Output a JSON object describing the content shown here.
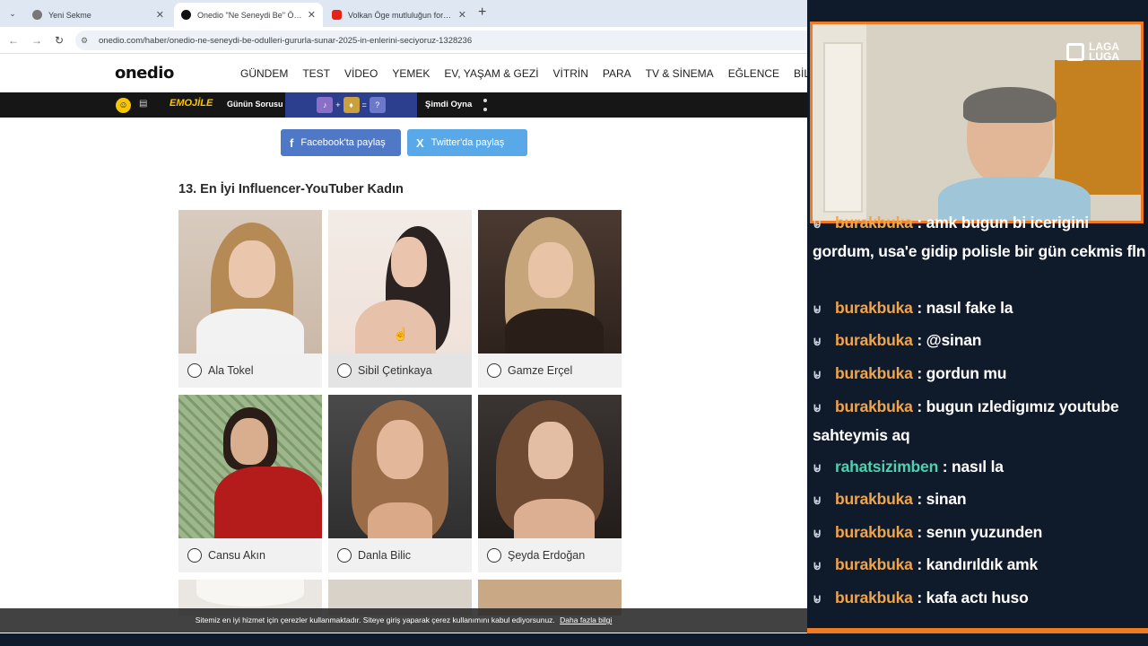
{
  "browser": {
    "tabs": [
      {
        "title": "Yeni Sekme",
        "active": false
      },
      {
        "title": "Onedio \"Ne Seneydi Be\" Ödülle",
        "active": true
      },
      {
        "title": "Volkan Öge mutluluğun formülü",
        "active": false
      }
    ],
    "url": "onedio.com/haber/onedio-ne-seneydi-be-odulleri-gururla-sunar-2025-in-enlerini-seciyoruz-1328236"
  },
  "site": {
    "logo": "onedio",
    "menu": [
      "GÜNDEM",
      "TEST",
      "VİDEO",
      "YEMEK",
      "EV, YAŞAM & GEZİ",
      "VİTRİN",
      "PARA",
      "TV & SİNEMA",
      "EĞLENCE",
      "BİLGİS"
    ],
    "promo": {
      "brand": "EMOJİLE",
      "question": "Günün Sorusu",
      "equation": [
        "+",
        "=",
        "?"
      ],
      "play": "Şimdi Oyna"
    },
    "share": {
      "facebook": "Facebook'ta paylaş",
      "twitter": "Twitter'da paylaş",
      "facebook_icon": "f",
      "twitter_icon": "X"
    },
    "question_title": "13. En İyi Influencer-YouTuber Kadın",
    "options": [
      {
        "name": "Ala Tokel",
        "selected": false
      },
      {
        "name": "Sibil Çetinkaya",
        "selected": false
      },
      {
        "name": "Gamze Erçel",
        "selected": false
      },
      {
        "name": "Cansu Akın",
        "selected": false
      },
      {
        "name": "Danla Bilic",
        "selected": false
      },
      {
        "name": "Şeyda Erdoğan",
        "selected": false
      }
    ],
    "cookie": {
      "text": "Sitemiz en iyi hizmet için çerezler kullanmaktadır. Siteye giriş yaparak çerez kullanımını kabul ediyorsunuz.",
      "link": "Daha fazla bilgi"
    }
  },
  "stream": {
    "logo": [
      "LAGA",
      "LUGA"
    ],
    "chat": [
      {
        "user": "burakbuka",
        "message": "amk bugun bi icerigini gordum, usa'e gidip polisle bir gün cekmis fln"
      },
      {
        "user": "burakbuka",
        "message": "nasıl fake la"
      },
      {
        "user": "burakbuka",
        "message": "@sinan"
      },
      {
        "user": "burakbuka",
        "message": "gordun mu"
      },
      {
        "user": "burakbuka",
        "message": "bugun ızledigımız youtube sahteymis aq"
      },
      {
        "user": "rahatsizimben",
        "message": "nasıl la"
      },
      {
        "user": "burakbuka",
        "message": "sinan"
      },
      {
        "user": "burakbuka",
        "message": "senın yuzunden"
      },
      {
        "user": "burakbuka",
        "message": "kandırıldık amk"
      },
      {
        "user": "burakbuka",
        "message": "kafa actı huso"
      }
    ]
  },
  "colors": {
    "accent": "#f07a21",
    "username": "#f2a548",
    "username_alt": "#4fd1b0",
    "facebook": "#4f78c6",
    "twitter": "#59a9e8"
  }
}
